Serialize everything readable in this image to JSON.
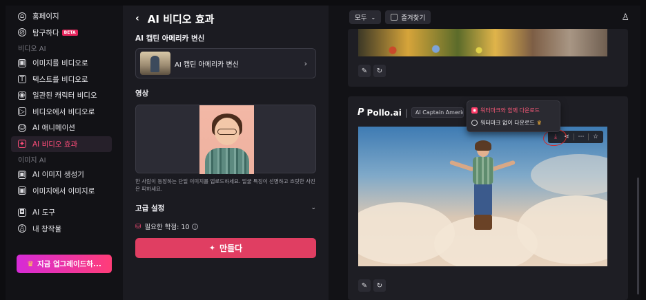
{
  "sidebar": {
    "items": [
      {
        "label": "홈페이지",
        "icon": "home-icon",
        "glyph": "⌂"
      },
      {
        "label": "탐구하다",
        "icon": "compass-icon",
        "glyph": "⊘",
        "badge": "BETA"
      }
    ],
    "section_video": "비디오 AI",
    "video_items": [
      {
        "label": "이미지를 비디오로",
        "icon": "image-to-video-icon",
        "glyph": "▣"
      },
      {
        "label": "텍스트를 비디오로",
        "icon": "text-to-video-icon",
        "glyph": "T"
      },
      {
        "label": "일관된 캐릭터 비디오",
        "icon": "character-video-icon",
        "glyph": "◉"
      },
      {
        "label": "비디오에서 비디오로",
        "icon": "video-to-video-icon",
        "glyph": "▷"
      },
      {
        "label": "AI 애니메이션",
        "icon": "animation-icon",
        "glyph": "☺"
      },
      {
        "label": "AI 비디오 효과",
        "icon": "video-effects-icon",
        "glyph": "✦",
        "active": true
      }
    ],
    "section_image": "이미지 AI",
    "image_items": [
      {
        "label": "AI 이미지 생성기",
        "icon": "image-generator-icon",
        "glyph": "▣"
      },
      {
        "label": "이미지에서 이미지로",
        "icon": "image-to-image-icon",
        "glyph": "▣"
      }
    ],
    "tools_items": [
      {
        "label": "AI 도구",
        "icon": "tools-icon",
        "glyph": "◘"
      },
      {
        "label": "내 창작물",
        "icon": "my-creations-icon",
        "glyph": "♙"
      }
    ],
    "upgrade_label": "지금 업그레이드하..."
  },
  "panel": {
    "title": "AI 비디오 효과",
    "effect_label": "AI 캡틴 아메리카 변신",
    "effect_name": "AI 캡틴 아메리카 변신",
    "media_label": "영상",
    "hint": "한 사람이 등장하는 단일 이미지를 업로드하세요. 얼굴 특징이 선명하고 흐릿한 사진은 피하세요.",
    "advanced_label": "고급 설정",
    "credits_label": "필요한 학점: 10",
    "make_label": "만들다"
  },
  "right": {
    "filter_label": "모두",
    "favorites_label": "즐겨찾기",
    "brand": "Pollo.ai",
    "chip": "AI Captain America",
    "dropdown": {
      "with_watermark": "워터마크와 함께 다운로드",
      "without_watermark": "워터마크 없이 다운로드"
    }
  },
  "colors": {
    "accent": "#ff4d7a",
    "button": "#e03e62",
    "background": "#121216",
    "panel": "#1b1b21"
  }
}
